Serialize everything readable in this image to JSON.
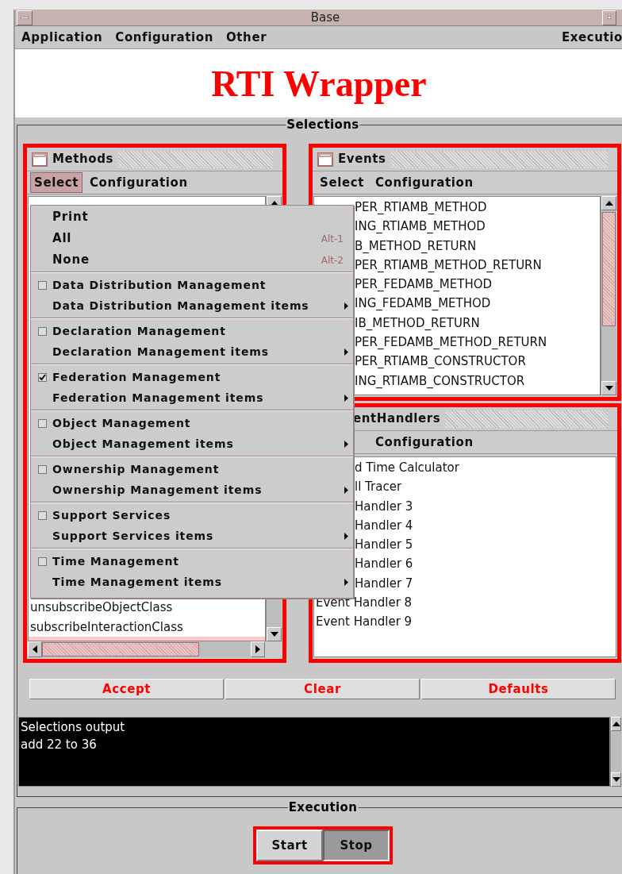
{
  "window": {
    "title": "Base"
  },
  "menu_bar": {
    "items": [
      "Application",
      "Configuration",
      "Other"
    ],
    "right_items": [
      "Executio"
    ]
  },
  "banner": {
    "title": "RTI Wrapper"
  },
  "selections": {
    "label": "Selections",
    "methods": {
      "title": "Methods",
      "menu": [
        {
          "label": "Select",
          "selected": true
        },
        {
          "label": "Configuration",
          "selected": false
        }
      ],
      "rows": [
        "unsubscribeObjectClass",
        "subscribeInteractionClass"
      ]
    },
    "events": {
      "title": "Events",
      "menu": [
        {
          "label": "Select",
          "selected": false
        },
        {
          "label": "Configuration",
          "selected": false
        }
      ],
      "rows": [
        "PER_RTIAMB_METHOD",
        "ING_RTIAMB_METHOD",
        "B_METHOD_RETURN",
        "PER_RTIAMB_METHOD_RETURN",
        "PER_FEDAMB_METHOD",
        "ING_FEDAMB_METHOD",
        "IB_METHOD_RETURN",
        "PER_FEDAMB_METHOD_RETURN",
        "PER_RTIAMB_CONSTRUCTOR",
        "ING_RTIAMB_CONSTRUCTOR"
      ]
    },
    "event_handlers": {
      "title": "entHandlers",
      "menu": [
        {
          "label": "Configuration",
          "selected": false
        }
      ],
      "rows": [
        "d Time Calculator",
        "ll Tracer",
        "Handler 3",
        "Handler 4",
        "Handler 5",
        "Handler 6",
        "Handler 7",
        "Event Handler 8",
        "Event Handler 9"
      ]
    },
    "buttons": [
      "Accept",
      "Clear",
      "Defaults"
    ],
    "output": {
      "lines": [
        "Selections output",
        "add 22 to 36"
      ]
    }
  },
  "execution": {
    "label": "Execution",
    "buttons": [
      {
        "label": "Start",
        "pressed": false
      },
      {
        "label": "Stop",
        "pressed": true
      }
    ]
  },
  "select_menu": {
    "commands": [
      {
        "label": "Print"
      },
      {
        "label": "All",
        "shortcut": "Alt-1"
      },
      {
        "label": "None",
        "shortcut": "Alt-2"
      }
    ],
    "groups": [
      {
        "label": "Data Distribution Management",
        "checked": false,
        "submenu": "Data Distribution Management items"
      },
      {
        "label": "Declaration Management",
        "checked": false,
        "submenu": "Declaration Management items"
      },
      {
        "label": "Federation Management",
        "checked": true,
        "submenu": "Federation Management items"
      },
      {
        "label": "Object Management",
        "checked": false,
        "submenu": "Object Management items"
      },
      {
        "label": "Ownership Management",
        "checked": false,
        "submenu": "Ownership Management items"
      },
      {
        "label": "Support Services",
        "checked": false,
        "submenu": "Support Services items"
      },
      {
        "label": "Time Management",
        "checked": false,
        "submenu": "Time Management items"
      }
    ]
  }
}
